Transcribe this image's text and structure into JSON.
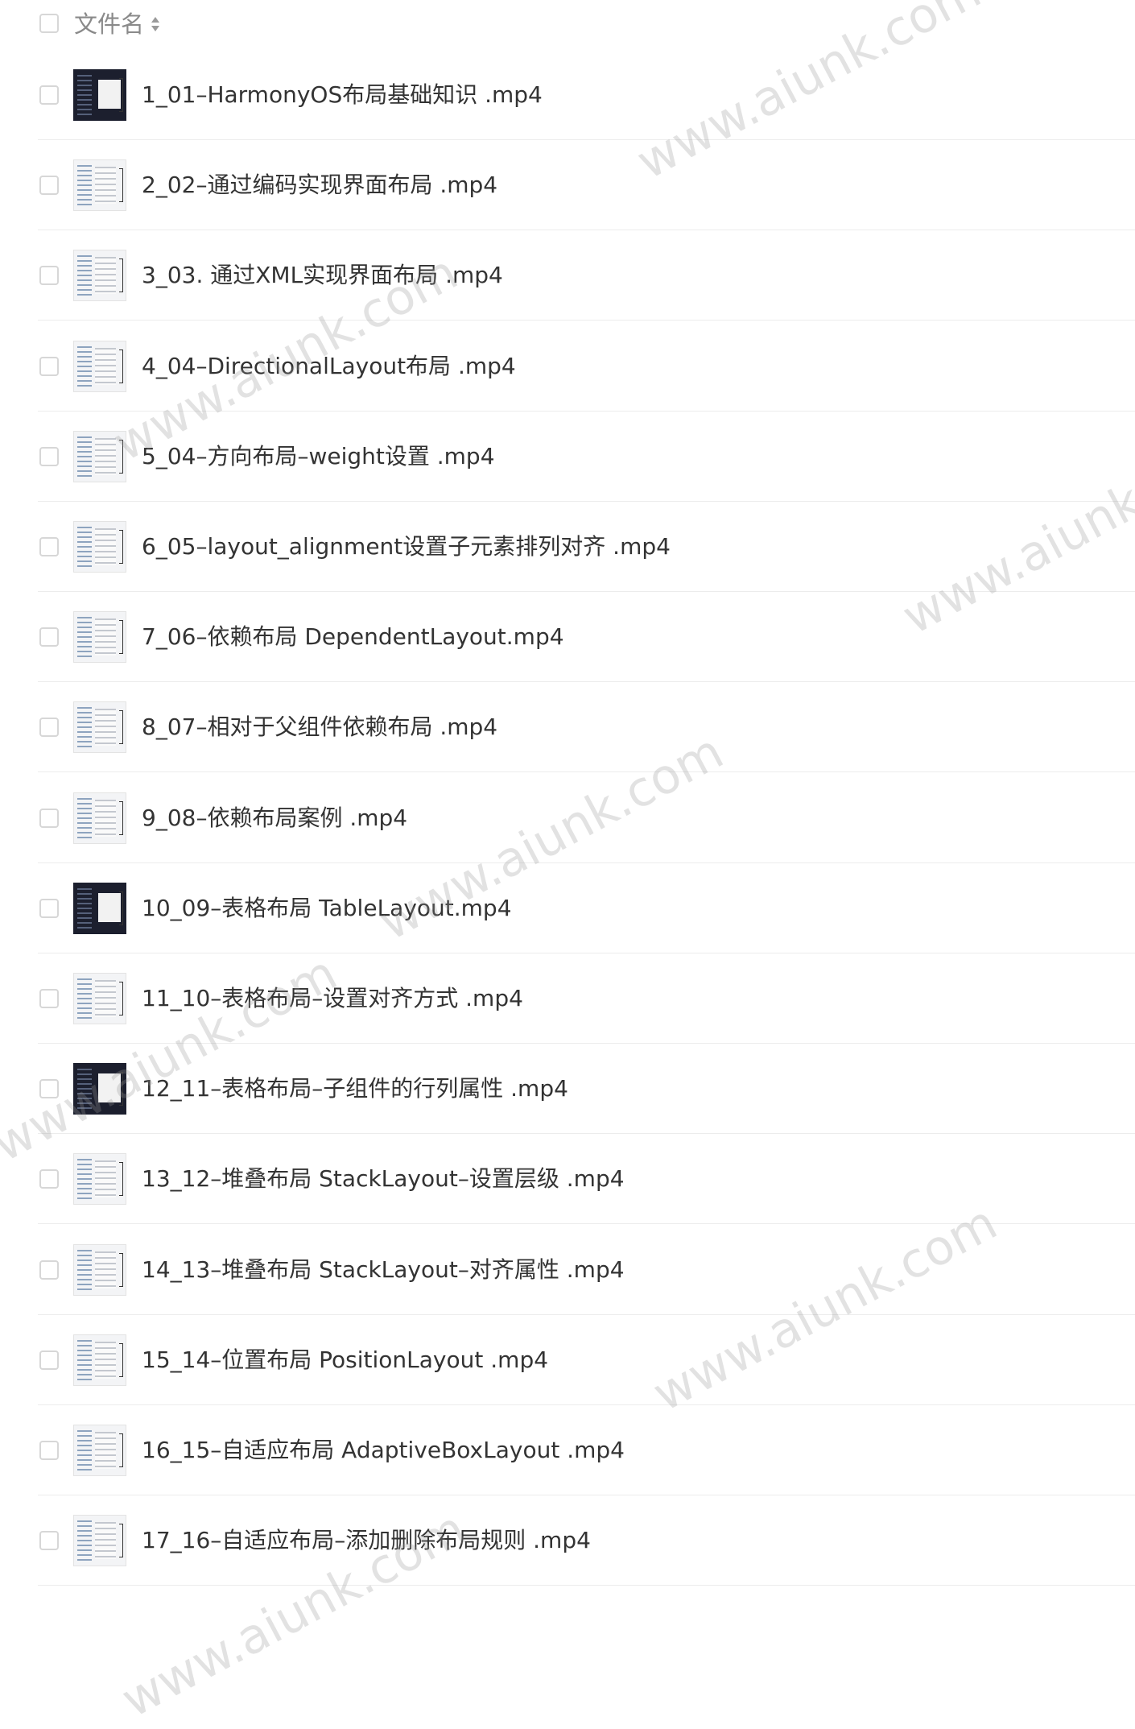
{
  "header": {
    "label": "文件名"
  },
  "files": [
    {
      "name": "1_01–HarmonyOS布局基础知识 .mp4",
      "thumb": "dark"
    },
    {
      "name": "2_02–通过编码实现界面布局 .mp4",
      "thumb": "light"
    },
    {
      "name": "3_03. 通过XML实现界面布局 .mp4",
      "thumb": "light"
    },
    {
      "name": "4_04–DirectionalLayout布局 .mp4",
      "thumb": "light"
    },
    {
      "name": "5_04–方向布局–weight设置 .mp4",
      "thumb": "light"
    },
    {
      "name": "6_05–layout_alignment设置子元素排列对齐 .mp4",
      "thumb": "light"
    },
    {
      "name": "7_06–依赖布局 DependentLayout.mp4",
      "thumb": "light"
    },
    {
      "name": "8_07–相对于父组件依赖布局 .mp4",
      "thumb": "light"
    },
    {
      "name": "9_08–依赖布局案例 .mp4",
      "thumb": "light"
    },
    {
      "name": "10_09–表格布局 TableLayout.mp4",
      "thumb": "dark"
    },
    {
      "name": "11_10–表格布局–设置对齐方式 .mp4",
      "thumb": "light"
    },
    {
      "name": "12_11–表格布局–子组件的行列属性 .mp4",
      "thumb": "dark"
    },
    {
      "name": "13_12–堆叠布局 StackLayout–设置层级 .mp4",
      "thumb": "light"
    },
    {
      "name": "14_13–堆叠布局 StackLayout–对齐属性 .mp4",
      "thumb": "light"
    },
    {
      "name": "15_14–位置布局 PositionLayout .mp4",
      "thumb": "light"
    },
    {
      "name": "16_15–自适应布局 AdaptiveBoxLayout .mp4",
      "thumb": "light"
    },
    {
      "name": "17_16–自适应布局–添加删除布局规则 .mp4",
      "thumb": "light"
    }
  ],
  "watermarks": [
    "www.aiunk.com",
    "www.aiunk.com",
    "www.aiunk.com",
    "www.aiunk.com",
    "www.aiunk.com",
    "www.aiunk.com",
    "www.aiunk.com"
  ]
}
